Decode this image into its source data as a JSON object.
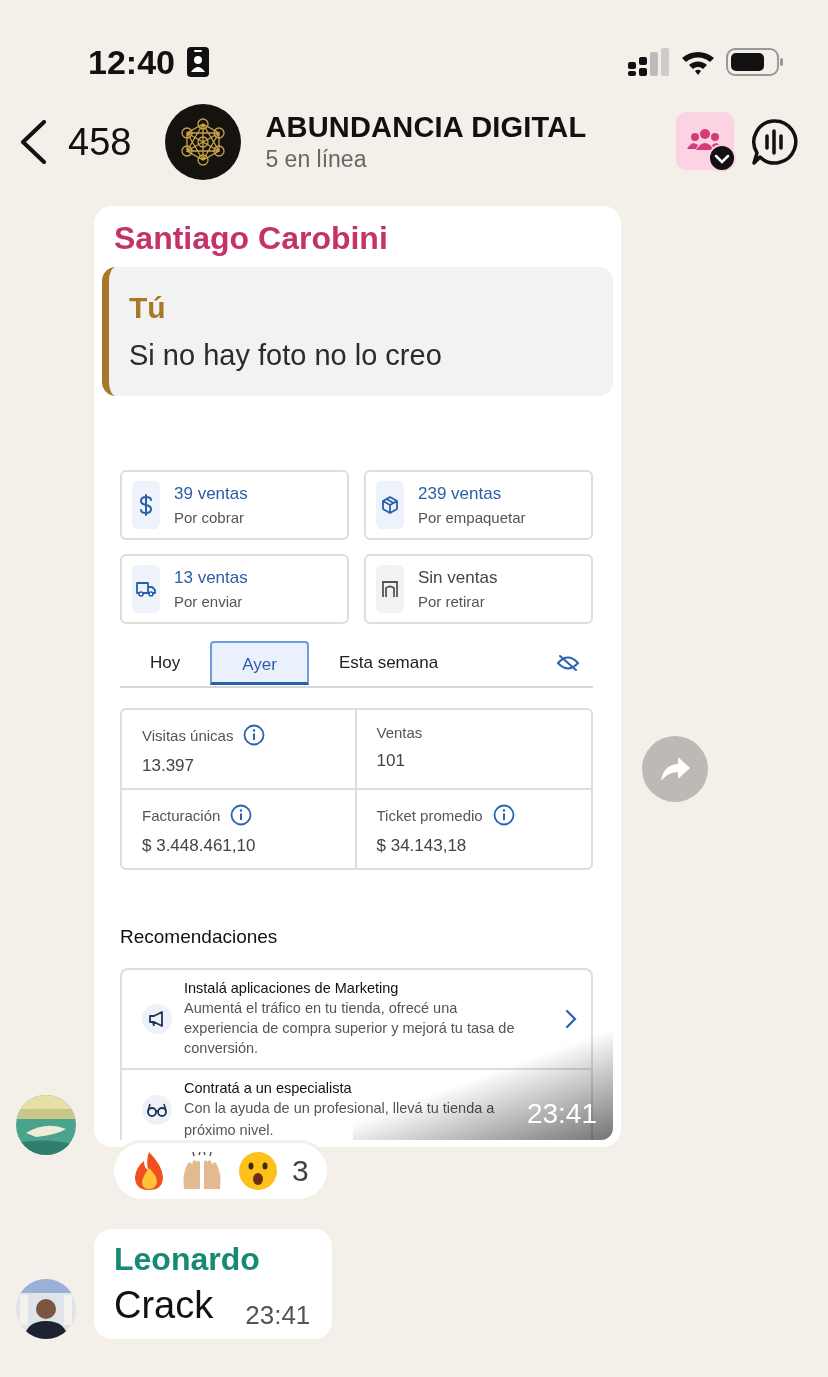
{
  "status_bar": {
    "time": "12:40"
  },
  "header": {
    "back_count": "458",
    "title": "ABUNDANCIA DIGITAL",
    "subtitle": "5 en línea"
  },
  "messages": [
    {
      "sender": "Santiago Carobini",
      "color": "#c4326a",
      "quote": {
        "author": "Tú",
        "text": "Si no hay foto no lo creo"
      },
      "image": {
        "cards": [
          {
            "title": "39 ventas",
            "subtitle": "Por cobrar",
            "active": true
          },
          {
            "title": "239 ventas",
            "subtitle": "Por empaquetar",
            "active": true
          },
          {
            "title": "13 ventas",
            "subtitle": "Por enviar",
            "active": true
          },
          {
            "title": "Sin ventas",
            "subtitle": "Por retirar",
            "active": false
          }
        ],
        "tabs": [
          {
            "label": "Hoy",
            "selected": false
          },
          {
            "label": "Ayer",
            "selected": true
          },
          {
            "label": "Esta semana",
            "selected": false
          }
        ],
        "stats": [
          {
            "label": "Visitas únicas",
            "value": "13.397",
            "info": true
          },
          {
            "label": "Ventas",
            "value": "101",
            "info": false
          },
          {
            "label": "Facturación",
            "value": "$ 3.448.461,10",
            "info": true
          },
          {
            "label": "Ticket promedio",
            "value": "$ 34.143,18",
            "info": true
          }
        ],
        "recommendations_title": "Recomendaciones",
        "recommendations": [
          {
            "title": "Instalá aplicaciones de Marketing",
            "text": "Aumentá el tráfico en tu tienda, ofrecé una experiencia de compra superior y mejorá tu tasa de conversión."
          },
          {
            "title": "Contratá a un especialista",
            "text": "Con la ayuda de un profesional, llevá tu tienda a",
            "text_2": "próximo nivel."
          }
        ]
      },
      "time": "23:41",
      "reactions": {
        "count": "3"
      }
    },
    {
      "kind": "text",
      "sender": "Leonardo",
      "color": "#168a72",
      "text": "Crack",
      "time": "23:41"
    }
  ]
}
